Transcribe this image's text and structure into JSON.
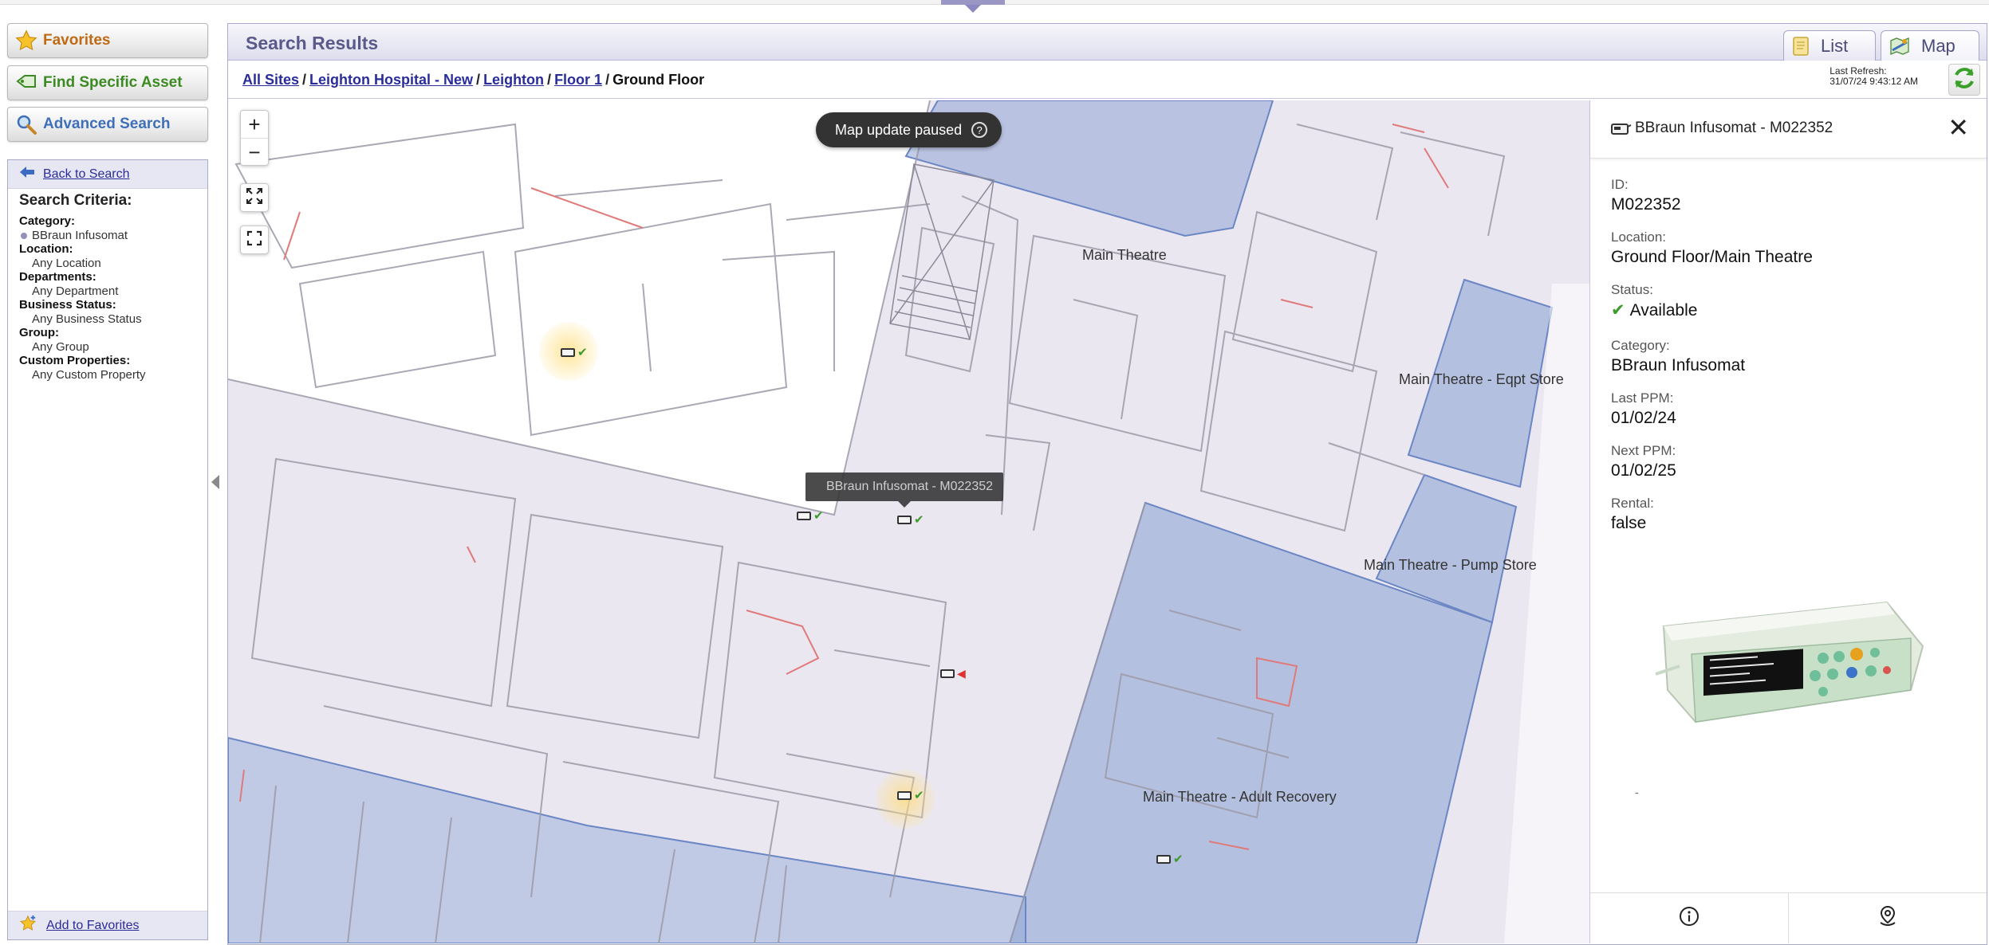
{
  "nav": {
    "favorites_label": "Favorites",
    "find_asset_label": "Find Specific Asset",
    "advanced_search_label": "Advanced Search"
  },
  "criteria": {
    "back_label": "Back to Search",
    "title": "Search Criteria:",
    "items": [
      {
        "label": "Category:",
        "value": "BBraun Infusomat"
      },
      {
        "label": "Location:",
        "value": "Any Location"
      },
      {
        "label": "Departments:",
        "value": "Any Department"
      },
      {
        "label": "Business Status:",
        "value": "Any Business Status"
      },
      {
        "label": "Group:",
        "value": "Any Group"
      },
      {
        "label": "Custom Properties:",
        "value": "Any Custom Property"
      }
    ],
    "add_favorites_label": "Add to Favorites"
  },
  "header": {
    "title": "Search Results",
    "tabs": [
      {
        "label": "List",
        "active": false
      },
      {
        "label": "Map",
        "active": true
      }
    ]
  },
  "breadcrumb": {
    "links": [
      "All Sites",
      "Leighton Hospital - New",
      "Leighton",
      "Floor 1"
    ],
    "separator": "/",
    "current": "Ground Floor"
  },
  "refresh": {
    "label": "Last Refresh:",
    "timestamp": "31/07/24 9:43:12 AM"
  },
  "map": {
    "zoom_in": "+",
    "zoom_out": "−",
    "paused_label": "Map update paused",
    "paused_help": "?",
    "tooltip": "BBraun Infusomat - M022352",
    "rooms": [
      "Main Theatre",
      "Main Theatre - Eqpt Store",
      "Main Theatre - Pump Store",
      "Main Theatre - Adult Recovery"
    ],
    "colors": {
      "zone": "#8fa6d4",
      "zone_border": "#6b86c4",
      "floor": "#ebe7f1",
      "highlight": "#ffdd78"
    }
  },
  "details": {
    "title": "BBraun Infusomat - M022352",
    "fields": [
      {
        "label": "ID:",
        "value": "M022352"
      },
      {
        "label": "Location:",
        "value": "Ground Floor/Main Theatre"
      },
      {
        "label": "Status:",
        "value": "Available"
      },
      {
        "label": "Category:",
        "value": "BBraun Infusomat"
      },
      {
        "label": "Last PPM:",
        "value": "01/02/24"
      },
      {
        "label": "Next PPM:",
        "value": "01/02/25"
      },
      {
        "label": "Rental:",
        "value": "false"
      }
    ],
    "image_caption": "-"
  }
}
